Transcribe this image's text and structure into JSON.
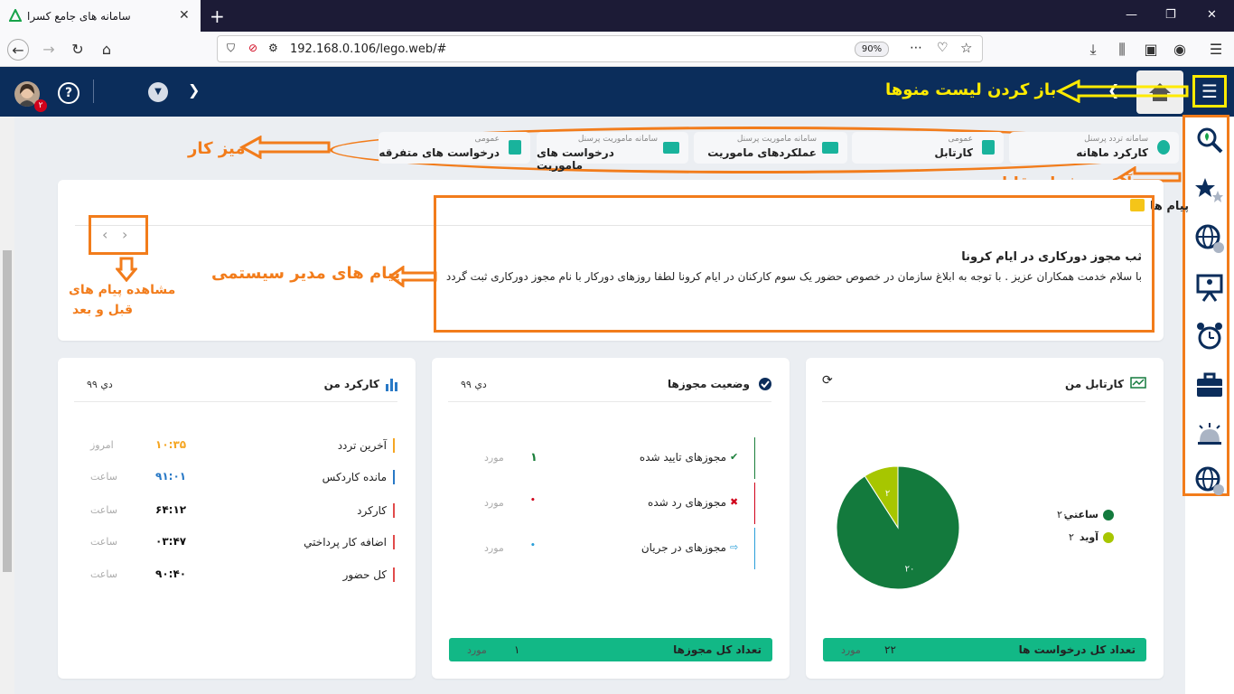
{
  "browser": {
    "tab_title": "سامانه های جامع کسرا",
    "tab_close": "✕",
    "new_tab": "+",
    "url": "192.168.0.106/lego.web/#",
    "zoom": "90%"
  },
  "header": {
    "menu_icon": "☰",
    "help": "?",
    "avatar_badge": "۲"
  },
  "annotations": {
    "open_menu": "باز کردن لیست منوها",
    "desktop": "میز کار",
    "accessible_pages_icon": "آیکن صفحات قابل دسترس",
    "system_admin_messages": "پیام های مدیر سیستمی",
    "view_prev_next_line1": "مشاهده پیام های",
    "view_prev_next_line2": "قبل و بعد"
  },
  "shortcuts": [
    {
      "sub": "سامانه تردد پرسنل",
      "label": "کارکرد ماهانه"
    },
    {
      "sub": "عمومی",
      "label": "کارتابل"
    },
    {
      "sub": "سامانه ماموریت پرسنل",
      "label": "عملکردهای ماموریت"
    },
    {
      "sub": "سامانه ماموریت پرسنل",
      "label": "درخواست های ماموریت"
    },
    {
      "sub": "عمومی",
      "label": "درخواست های متفرقه"
    }
  ],
  "messages": {
    "title": "پیام ها",
    "heading": "ثب مجوز دورکاری در ایام کرونا",
    "body": "با سلام خدمت همکاران عزیز  . با توجه به ابلاغ سازمان در خصوص حضور یک سوم کارکنان در ایام کرونا لطفا روزهای دورکار با نام مجوز دورکاری ثبت گردد"
  },
  "my_work": {
    "title": "کارکرد من",
    "date": "دي ۹۹",
    "rows": [
      {
        "label": "آخرین تردد",
        "value": "۱۰:۳۵",
        "unit": "امروز",
        "color": "#f5a623"
      },
      {
        "label": "مانده کاردکس",
        "value": "۹۱:۰۱",
        "unit": "ساعت",
        "color": "#2979c6"
      },
      {
        "label": "کارکرد",
        "value": "۶۴:۱۲",
        "unit": "ساعت",
        "color": "#e14b4b"
      },
      {
        "label": "اضافه کار پرداختي",
        "value": "۰۳:۴۷",
        "unit": "ساعت",
        "color": "#e14b4b"
      },
      {
        "label": "کل حضور",
        "value": "۹۰:۴۰",
        "unit": "ساعت",
        "color": "#e14b4b"
      }
    ]
  },
  "permits": {
    "title": "وضعیت مجوزها",
    "date": "دي ۹۹",
    "rows": [
      {
        "label": "مجوزهای تایید شده",
        "value": "۱",
        "unit": "مورد",
        "icon": "✔",
        "color": "#1b7f3b"
      },
      {
        "label": "مجوزهای رد شده",
        "value": "•",
        "unit": "مورد",
        "icon": "✖",
        "color": "#d0021b"
      },
      {
        "label": "مجوزهای در جریان",
        "value": "•",
        "unit": "مورد",
        "icon": "⇨",
        "color": "#2b9fd9"
      }
    ],
    "footer_label": "تعداد کل مجوزها",
    "footer_value": "۱",
    "footer_unit": "مورد"
  },
  "inbox": {
    "title": "کارتابل من",
    "refresh": "⟳",
    "legend": [
      {
        "label": "ساعتي",
        "value": "۲۰",
        "color": "#137a3d"
      },
      {
        "label": "آوید",
        "value": "۲",
        "color": "#a7c600"
      }
    ],
    "footer_label": "تعداد کل درخواست ها",
    "footer_value": "۲۲",
    "footer_unit": "مورد"
  },
  "chart_data": {
    "type": "pie",
    "categories": [
      "ساعتي",
      "آوید"
    ],
    "values": [
      20,
      2
    ],
    "data_labels": [
      "۲۰",
      "۲"
    ],
    "colors": [
      "#137a3d",
      "#a7c600"
    ],
    "legend_position": "right"
  }
}
